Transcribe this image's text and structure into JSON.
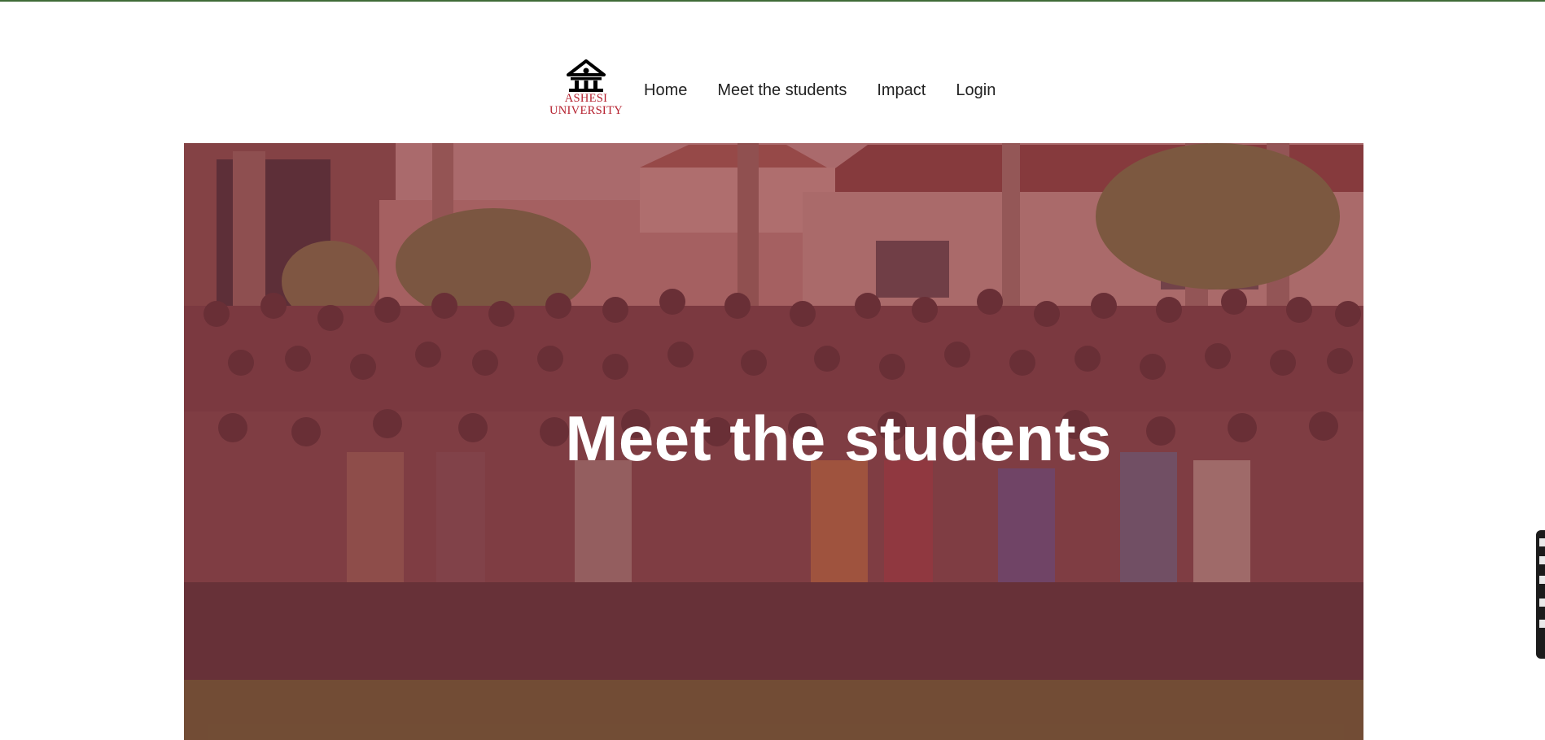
{
  "brand": {
    "line1": "ASHESI",
    "line2": "UNIVERSITY",
    "logo_icon": "university-building-icon",
    "color": "#b5202e"
  },
  "nav": {
    "items": [
      {
        "label": "Home"
      },
      {
        "label": "Meet the students"
      },
      {
        "label": "Impact"
      },
      {
        "label": "Login"
      }
    ]
  },
  "hero": {
    "title": "Meet the students",
    "overlay_color": "#7a1e2d"
  },
  "colors": {
    "top_rule": "#3f6b37",
    "title_text": "#ffffff"
  }
}
